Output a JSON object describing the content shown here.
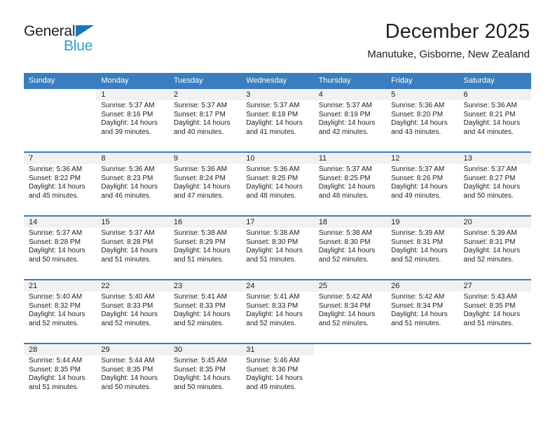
{
  "brand": {
    "name_part1": "General",
    "name_part2": "Blue",
    "triangle_color": "#1b75bb",
    "blue_text_color": "#2e9bd6"
  },
  "header": {
    "title": "December 2025",
    "subtitle": "Manutuke, Gisborne, New Zealand"
  },
  "theme": {
    "header_row_bg": "#3a7ebf",
    "header_row_text": "#ffffff",
    "daynum_band_bg": "#f1f1f1",
    "row_separator": "#3a7ebf"
  },
  "weekdays": [
    "Sunday",
    "Monday",
    "Tuesday",
    "Wednesday",
    "Thursday",
    "Friday",
    "Saturday"
  ],
  "labels": {
    "sunrise_prefix": "Sunrise:",
    "sunset_prefix": "Sunset:",
    "daylight_prefix": "Daylight:"
  },
  "weeks": [
    [
      {
        "day": "",
        "sunrise": "",
        "sunset": "",
        "daylight": "",
        "blank": true
      },
      {
        "day": "1",
        "sunrise": "Sunrise: 5:37 AM",
        "sunset": "Sunset: 8:16 PM",
        "daylight": "Daylight: 14 hours and 39 minutes."
      },
      {
        "day": "2",
        "sunrise": "Sunrise: 5:37 AM",
        "sunset": "Sunset: 8:17 PM",
        "daylight": "Daylight: 14 hours and 40 minutes."
      },
      {
        "day": "3",
        "sunrise": "Sunrise: 5:37 AM",
        "sunset": "Sunset: 8:18 PM",
        "daylight": "Daylight: 14 hours and 41 minutes."
      },
      {
        "day": "4",
        "sunrise": "Sunrise: 5:37 AM",
        "sunset": "Sunset: 8:19 PM",
        "daylight": "Daylight: 14 hours and 42 minutes."
      },
      {
        "day": "5",
        "sunrise": "Sunrise: 5:36 AM",
        "sunset": "Sunset: 8:20 PM",
        "daylight": "Daylight: 14 hours and 43 minutes."
      },
      {
        "day": "6",
        "sunrise": "Sunrise: 5:36 AM",
        "sunset": "Sunset: 8:21 PM",
        "daylight": "Daylight: 14 hours and 44 minutes."
      }
    ],
    [
      {
        "day": "7",
        "sunrise": "Sunrise: 5:36 AM",
        "sunset": "Sunset: 8:22 PM",
        "daylight": "Daylight: 14 hours and 45 minutes."
      },
      {
        "day": "8",
        "sunrise": "Sunrise: 5:36 AM",
        "sunset": "Sunset: 8:23 PM",
        "daylight": "Daylight: 14 hours and 46 minutes."
      },
      {
        "day": "9",
        "sunrise": "Sunrise: 5:36 AM",
        "sunset": "Sunset: 8:24 PM",
        "daylight": "Daylight: 14 hours and 47 minutes."
      },
      {
        "day": "10",
        "sunrise": "Sunrise: 5:36 AM",
        "sunset": "Sunset: 8:25 PM",
        "daylight": "Daylight: 14 hours and 48 minutes."
      },
      {
        "day": "11",
        "sunrise": "Sunrise: 5:37 AM",
        "sunset": "Sunset: 8:25 PM",
        "daylight": "Daylight: 14 hours and 48 minutes."
      },
      {
        "day": "12",
        "sunrise": "Sunrise: 5:37 AM",
        "sunset": "Sunset: 8:26 PM",
        "daylight": "Daylight: 14 hours and 49 minutes."
      },
      {
        "day": "13",
        "sunrise": "Sunrise: 5:37 AM",
        "sunset": "Sunset: 8:27 PM",
        "daylight": "Daylight: 14 hours and 50 minutes."
      }
    ],
    [
      {
        "day": "14",
        "sunrise": "Sunrise: 5:37 AM",
        "sunset": "Sunset: 8:28 PM",
        "daylight": "Daylight: 14 hours and 50 minutes."
      },
      {
        "day": "15",
        "sunrise": "Sunrise: 5:37 AM",
        "sunset": "Sunset: 8:28 PM",
        "daylight": "Daylight: 14 hours and 51 minutes."
      },
      {
        "day": "16",
        "sunrise": "Sunrise: 5:38 AM",
        "sunset": "Sunset: 8:29 PM",
        "daylight": "Daylight: 14 hours and 51 minutes."
      },
      {
        "day": "17",
        "sunrise": "Sunrise: 5:38 AM",
        "sunset": "Sunset: 8:30 PM",
        "daylight": "Daylight: 14 hours and 51 minutes."
      },
      {
        "day": "18",
        "sunrise": "Sunrise: 5:38 AM",
        "sunset": "Sunset: 8:30 PM",
        "daylight": "Daylight: 14 hours and 52 minutes."
      },
      {
        "day": "19",
        "sunrise": "Sunrise: 5:39 AM",
        "sunset": "Sunset: 8:31 PM",
        "daylight": "Daylight: 14 hours and 52 minutes."
      },
      {
        "day": "20",
        "sunrise": "Sunrise: 5:39 AM",
        "sunset": "Sunset: 8:31 PM",
        "daylight": "Daylight: 14 hours and 52 minutes."
      }
    ],
    [
      {
        "day": "21",
        "sunrise": "Sunrise: 5:40 AM",
        "sunset": "Sunset: 8:32 PM",
        "daylight": "Daylight: 14 hours and 52 minutes."
      },
      {
        "day": "22",
        "sunrise": "Sunrise: 5:40 AM",
        "sunset": "Sunset: 8:33 PM",
        "daylight": "Daylight: 14 hours and 52 minutes."
      },
      {
        "day": "23",
        "sunrise": "Sunrise: 5:41 AM",
        "sunset": "Sunset: 8:33 PM",
        "daylight": "Daylight: 14 hours and 52 minutes."
      },
      {
        "day": "24",
        "sunrise": "Sunrise: 5:41 AM",
        "sunset": "Sunset: 8:33 PM",
        "daylight": "Daylight: 14 hours and 52 minutes."
      },
      {
        "day": "25",
        "sunrise": "Sunrise: 5:42 AM",
        "sunset": "Sunset: 8:34 PM",
        "daylight": "Daylight: 14 hours and 52 minutes."
      },
      {
        "day": "26",
        "sunrise": "Sunrise: 5:42 AM",
        "sunset": "Sunset: 8:34 PM",
        "daylight": "Daylight: 14 hours and 51 minutes."
      },
      {
        "day": "27",
        "sunrise": "Sunrise: 5:43 AM",
        "sunset": "Sunset: 8:35 PM",
        "daylight": "Daylight: 14 hours and 51 minutes."
      }
    ],
    [
      {
        "day": "28",
        "sunrise": "Sunrise: 5:44 AM",
        "sunset": "Sunset: 8:35 PM",
        "daylight": "Daylight: 14 hours and 51 minutes."
      },
      {
        "day": "29",
        "sunrise": "Sunrise: 5:44 AM",
        "sunset": "Sunset: 8:35 PM",
        "daylight": "Daylight: 14 hours and 50 minutes."
      },
      {
        "day": "30",
        "sunrise": "Sunrise: 5:45 AM",
        "sunset": "Sunset: 8:35 PM",
        "daylight": "Daylight: 14 hours and 50 minutes."
      },
      {
        "day": "31",
        "sunrise": "Sunrise: 5:46 AM",
        "sunset": "Sunset: 8:36 PM",
        "daylight": "Daylight: 14 hours and 49 minutes."
      },
      {
        "day": "",
        "sunrise": "",
        "sunset": "",
        "daylight": "",
        "blank": true
      },
      {
        "day": "",
        "sunrise": "",
        "sunset": "",
        "daylight": "",
        "blank": true
      },
      {
        "day": "",
        "sunrise": "",
        "sunset": "",
        "daylight": "",
        "blank": true
      }
    ]
  ]
}
